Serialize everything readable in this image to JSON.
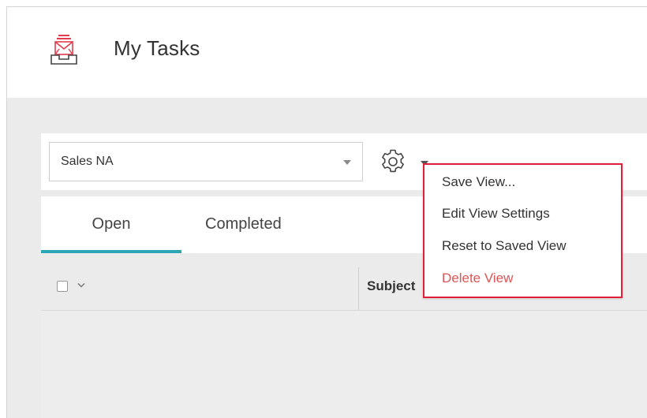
{
  "header": {
    "title": "My Tasks",
    "icon": "tasks-inbox-icon",
    "icon_color": "#e33b4e"
  },
  "toolbar": {
    "view_select": {
      "value": "Sales NA",
      "icon": "caret-down-icon"
    },
    "settings": {
      "icon": "gear-icon",
      "caret_icon": "caret-down-icon"
    }
  },
  "tabs": [
    {
      "label": "Open",
      "active": true
    },
    {
      "label": "Completed",
      "active": false
    }
  ],
  "grid": {
    "columns": [
      {
        "label": "Subject"
      }
    ],
    "select_all_icon": "chevron-down-icon"
  },
  "menu": {
    "items": [
      {
        "label": "Save View..."
      },
      {
        "label": "Edit View Settings"
      },
      {
        "label": "Reset to Saved View"
      },
      {
        "label": "Delete View"
      }
    ],
    "highlight_color": "#e0203a"
  },
  "colors": {
    "accent": "#2aa6b5",
    "danger": "#e05454"
  }
}
